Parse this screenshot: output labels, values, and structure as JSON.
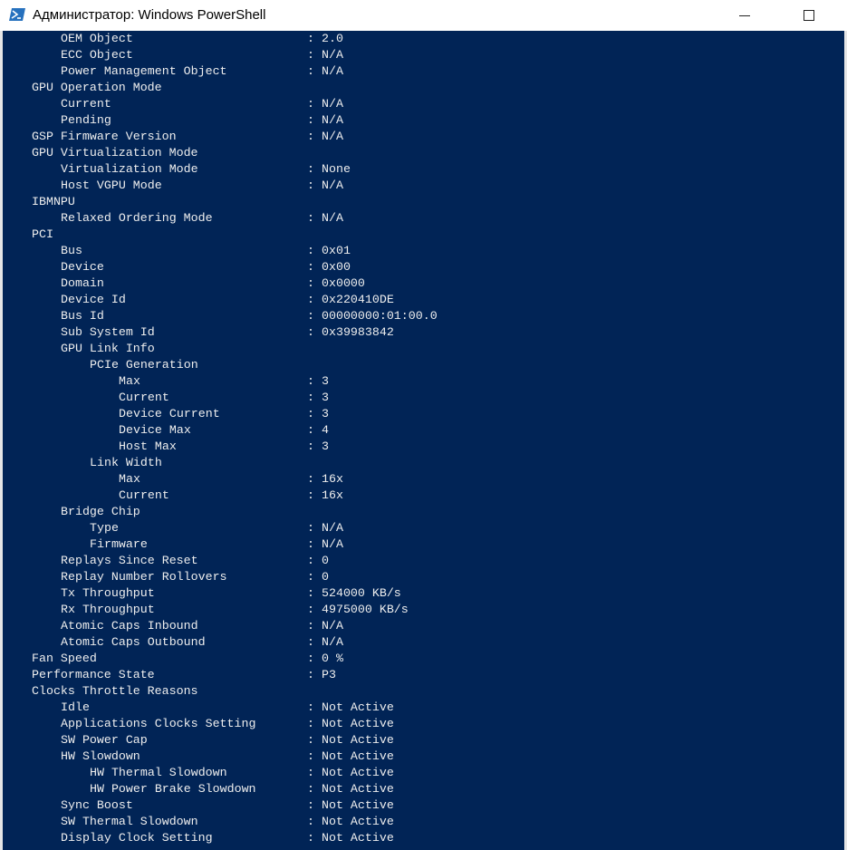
{
  "window": {
    "title": "Администратор: Windows PowerShell"
  },
  "icons": {
    "app": "powershell-icon",
    "minimize": "minimize-icon",
    "maximize": "maximize-icon"
  },
  "colors": {
    "console_background": "#012456",
    "console_text": "#eeeeee",
    "titlebar": "#ffffff"
  },
  "console": {
    "lines": [
      {
        "text": "OEM Object",
        "indent": 2,
        "value": "2.0"
      },
      {
        "text": "ECC Object",
        "indent": 2,
        "value": "N/A"
      },
      {
        "text": "Power Management Object",
        "indent": 2,
        "value": "N/A"
      },
      {
        "text": "GPU Operation Mode",
        "indent": 1,
        "value": null
      },
      {
        "text": "Current",
        "indent": 2,
        "value": "N/A"
      },
      {
        "text": "Pending",
        "indent": 2,
        "value": "N/A"
      },
      {
        "text": "GSP Firmware Version",
        "indent": 1,
        "value": "N/A"
      },
      {
        "text": "GPU Virtualization Mode",
        "indent": 1,
        "value": null
      },
      {
        "text": "Virtualization Mode",
        "indent": 2,
        "value": "None"
      },
      {
        "text": "Host VGPU Mode",
        "indent": 2,
        "value": "N/A"
      },
      {
        "text": "IBMNPU",
        "indent": 1,
        "value": null
      },
      {
        "text": "Relaxed Ordering Mode",
        "indent": 2,
        "value": "N/A"
      },
      {
        "text": "PCI",
        "indent": 1,
        "value": null
      },
      {
        "text": "Bus",
        "indent": 2,
        "value": "0x01"
      },
      {
        "text": "Device",
        "indent": 2,
        "value": "0x00"
      },
      {
        "text": "Domain",
        "indent": 2,
        "value": "0x0000"
      },
      {
        "text": "Device Id",
        "indent": 2,
        "value": "0x220410DE"
      },
      {
        "text": "Bus Id",
        "indent": 2,
        "value": "00000000:01:00.0"
      },
      {
        "text": "Sub System Id",
        "indent": 2,
        "value": "0x39983842"
      },
      {
        "text": "GPU Link Info",
        "indent": 2,
        "value": null
      },
      {
        "text": "PCIe Generation",
        "indent": 3,
        "value": null
      },
      {
        "text": "Max",
        "indent": 4,
        "value": "3"
      },
      {
        "text": "Current",
        "indent": 4,
        "value": "3"
      },
      {
        "text": "Device Current",
        "indent": 4,
        "value": "3"
      },
      {
        "text": "Device Max",
        "indent": 4,
        "value": "4"
      },
      {
        "text": "Host Max",
        "indent": 4,
        "value": "3"
      },
      {
        "text": "Link Width",
        "indent": 3,
        "value": null
      },
      {
        "text": "Max",
        "indent": 4,
        "value": "16x"
      },
      {
        "text": "Current",
        "indent": 4,
        "value": "16x"
      },
      {
        "text": "Bridge Chip",
        "indent": 2,
        "value": null
      },
      {
        "text": "Type",
        "indent": 3,
        "value": "N/A"
      },
      {
        "text": "Firmware",
        "indent": 3,
        "value": "N/A"
      },
      {
        "text": "Replays Since Reset",
        "indent": 2,
        "value": "0"
      },
      {
        "text": "Replay Number Rollovers",
        "indent": 2,
        "value": "0"
      },
      {
        "text": "Tx Throughput",
        "indent": 2,
        "value": "524000 KB/s"
      },
      {
        "text": "Rx Throughput",
        "indent": 2,
        "value": "4975000 KB/s"
      },
      {
        "text": "Atomic Caps Inbound",
        "indent": 2,
        "value": "N/A"
      },
      {
        "text": "Atomic Caps Outbound",
        "indent": 2,
        "value": "N/A"
      },
      {
        "text": "Fan Speed",
        "indent": 1,
        "value": "0 %"
      },
      {
        "text": "Performance State",
        "indent": 1,
        "value": "P3"
      },
      {
        "text": "Clocks Throttle Reasons",
        "indent": 1,
        "value": null
      },
      {
        "text": "Idle",
        "indent": 2,
        "value": "Not Active"
      },
      {
        "text": "Applications Clocks Setting",
        "indent": 2,
        "value": "Not Active"
      },
      {
        "text": "SW Power Cap",
        "indent": 2,
        "value": "Not Active"
      },
      {
        "text": "HW Slowdown",
        "indent": 2,
        "value": "Not Active"
      },
      {
        "text": "HW Thermal Slowdown",
        "indent": 3,
        "value": "Not Active"
      },
      {
        "text": "HW Power Brake Slowdown",
        "indent": 3,
        "value": "Not Active"
      },
      {
        "text": "Sync Boost",
        "indent": 2,
        "value": "Not Active"
      },
      {
        "text": "SW Thermal Slowdown",
        "indent": 2,
        "value": "Not Active"
      },
      {
        "text": "Display Clock Setting",
        "indent": 2,
        "value": "Not Active"
      }
    ]
  }
}
